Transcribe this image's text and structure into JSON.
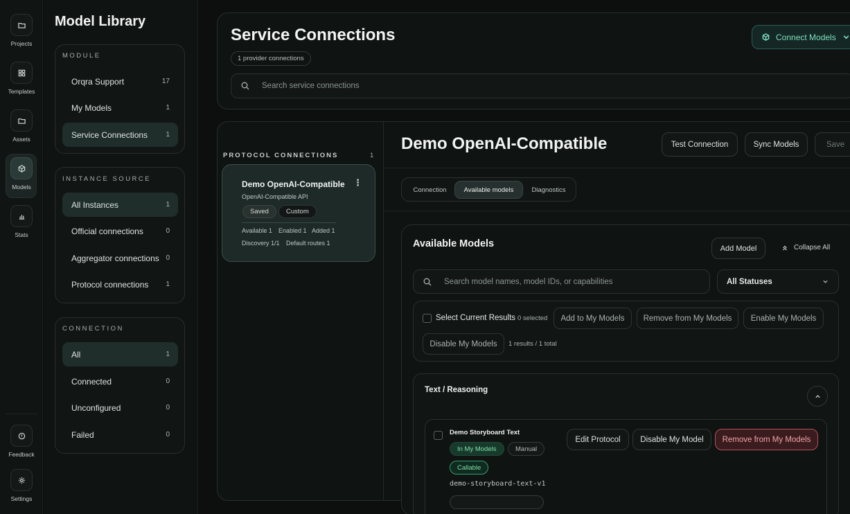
{
  "rail": {
    "items": [
      {
        "label": "Projects",
        "icon": "folder-icon"
      },
      {
        "label": "Templates",
        "icon": "grid-icon"
      },
      {
        "label": "Assets",
        "icon": "folder-icon"
      },
      {
        "label": "Models",
        "icon": "cube-icon",
        "active": true
      },
      {
        "label": "Stats",
        "icon": "bar-chart-icon"
      }
    ],
    "bottom": [
      {
        "label": "Feedback",
        "icon": "info-icon"
      },
      {
        "label": "Settings",
        "icon": "gear-icon"
      }
    ]
  },
  "library": {
    "title": "Model Library",
    "module": {
      "heading": "MODULE",
      "items": [
        {
          "label": "Orqra Support",
          "count": "17"
        },
        {
          "label": "My Models",
          "count": "1"
        },
        {
          "label": "Service Connections",
          "count": "1",
          "active": true
        }
      ]
    },
    "instance_source": {
      "heading": "INSTANCE SOURCE",
      "items": [
        {
          "label": "All Instances",
          "count": "1",
          "active": true
        },
        {
          "label": "Official connections",
          "count": "0"
        },
        {
          "label": "Aggregator connections",
          "count": "0"
        },
        {
          "label": "Protocol connections",
          "count": "1"
        }
      ]
    },
    "connection": {
      "heading": "CONNECTION",
      "items": [
        {
          "label": "All",
          "count": "1",
          "active": true
        },
        {
          "label": "Connected",
          "count": "0"
        },
        {
          "label": "Unconfigured",
          "count": "0"
        },
        {
          "label": "Failed",
          "count": "0"
        }
      ]
    }
  },
  "header": {
    "title": "Service Connections",
    "badge": "1 provider connections",
    "search_placeholder": "Search service connections",
    "connect_label": "Connect Models"
  },
  "protocols": {
    "heading": "PROTOCOL CONNECTIONS",
    "count": "1",
    "card": {
      "title": "Demo OpenAI-Compatible",
      "subtitle": "OpenAI-Compatible API",
      "tags": [
        "Saved",
        "Custom"
      ],
      "stats_row1": [
        "Available 1",
        "Enabled 1",
        "Added 1"
      ],
      "stats_row2": [
        "Discovery 1/1",
        "Default routes 1"
      ]
    }
  },
  "detail": {
    "title": "Demo OpenAI-Compatible",
    "actions": {
      "test": "Test Connection",
      "sync": "Sync Models",
      "save": "Save"
    },
    "tabs": [
      "Connection",
      "Available models",
      "Diagnostics"
    ],
    "active_tab": "Available models",
    "available": {
      "title": "Available Models",
      "add_model": "Add Model",
      "collapse_all": "Collapse All",
      "search_placeholder": "Search model names, model IDs, or capabilities",
      "status_filter": "All Statuses",
      "bulk": {
        "select_label": "Select Current Results",
        "selected": "0 selected",
        "add": "Add to My Models",
        "remove": "Remove from My Models",
        "enable": "Enable My Models",
        "disable": "Disable My Models",
        "results": "1 results / 1 total"
      },
      "group": {
        "title": "Text / Reasoning",
        "model": {
          "name": "Demo Storyboard Text",
          "tags": [
            "In My Models",
            "Manual"
          ],
          "callable": "Callable",
          "id": "demo-storyboard-text-v1",
          "edit": "Edit Protocol",
          "disable": "Disable My Model",
          "remove": "Remove from My Models"
        }
      }
    }
  },
  "colors": {
    "accent": "#7fe0c1",
    "danger": "#f0a3a8",
    "background": "#0c0f0e"
  }
}
